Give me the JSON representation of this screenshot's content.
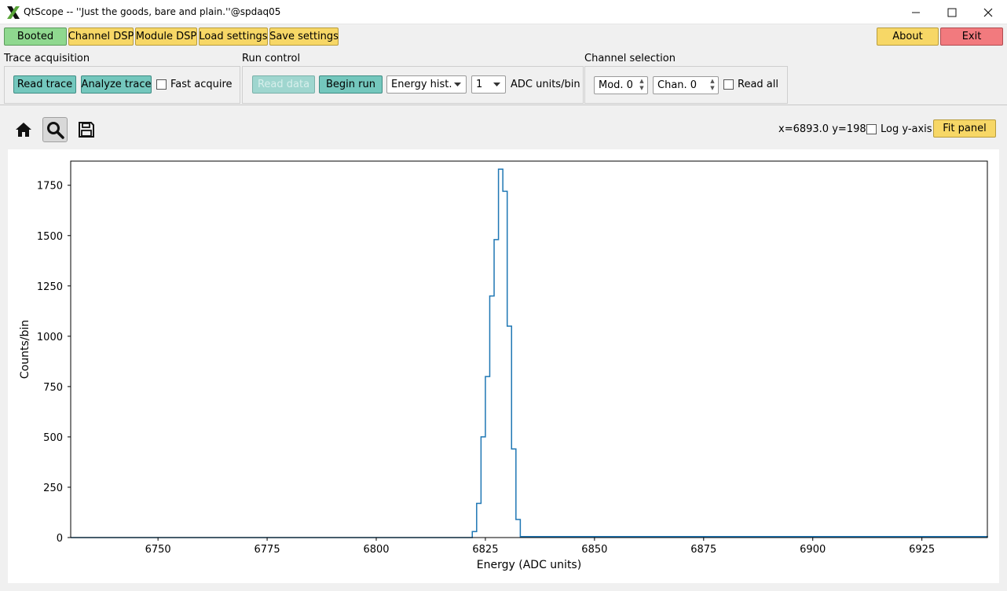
{
  "window": {
    "title": "QtScope -- ''Just the goods, bare and plain.''@spdaq05"
  },
  "toolbar": {
    "booted": "Booted",
    "channel_dsp": "Channel DSP",
    "module_dsp": "Module DSP",
    "load_settings": "Load settings",
    "save_settings": "Save settings",
    "about": "About",
    "exit": "Exit"
  },
  "trace_acquisition": {
    "label": "Trace acquisition",
    "read_trace": "Read trace",
    "analyze_trace": "Analyze trace",
    "fast_acquire": "Fast acquire"
  },
  "run_control": {
    "label": "Run control",
    "read_data": "Read data",
    "begin_run": "Begin run",
    "histogram_select": "Energy hist.",
    "binning_select": "1",
    "binning_unit": "ADC units/bin"
  },
  "channel_selection": {
    "label": "Channel selection",
    "module": "Mod. 0",
    "channel": "Chan. 0",
    "read_all": "Read all"
  },
  "plot_toolbar": {
    "coords": "x=6893.0 y=198.",
    "log_y": "Log y-axis",
    "fit_panel": "Fit panel"
  },
  "icons": {
    "home": "home-icon",
    "zoom": "magnifier-icon",
    "save": "floppy-disk-icon"
  },
  "colors": {
    "series": "#1f77b4",
    "booted": "#8fd88f",
    "yellow_button": "#f7d766",
    "exit": "#f27a7e",
    "teal_button": "#74c7bd"
  },
  "chart_data": {
    "type": "line",
    "title": "",
    "xlabel": "Energy (ADC units)",
    "ylabel": "Counts/bin",
    "xlim": [
      6730,
      6940
    ],
    "ylim": [
      0,
      1870
    ],
    "xticks": [
      6750,
      6775,
      6800,
      6825,
      6850,
      6875,
      6900,
      6925
    ],
    "yticks": [
      0,
      250,
      500,
      750,
      1000,
      1250,
      1500,
      1750
    ],
    "grid": false,
    "series": [
      {
        "x": [
          6730,
          6821,
          6822,
          6823,
          6824,
          6825,
          6826,
          6827,
          6828,
          6829,
          6830,
          6831,
          6832,
          6833,
          6940
        ],
        "y": [
          0,
          0,
          30,
          170,
          500,
          800,
          1200,
          1480,
          1830,
          1720,
          1050,
          440,
          90,
          5,
          0
        ]
      }
    ]
  }
}
